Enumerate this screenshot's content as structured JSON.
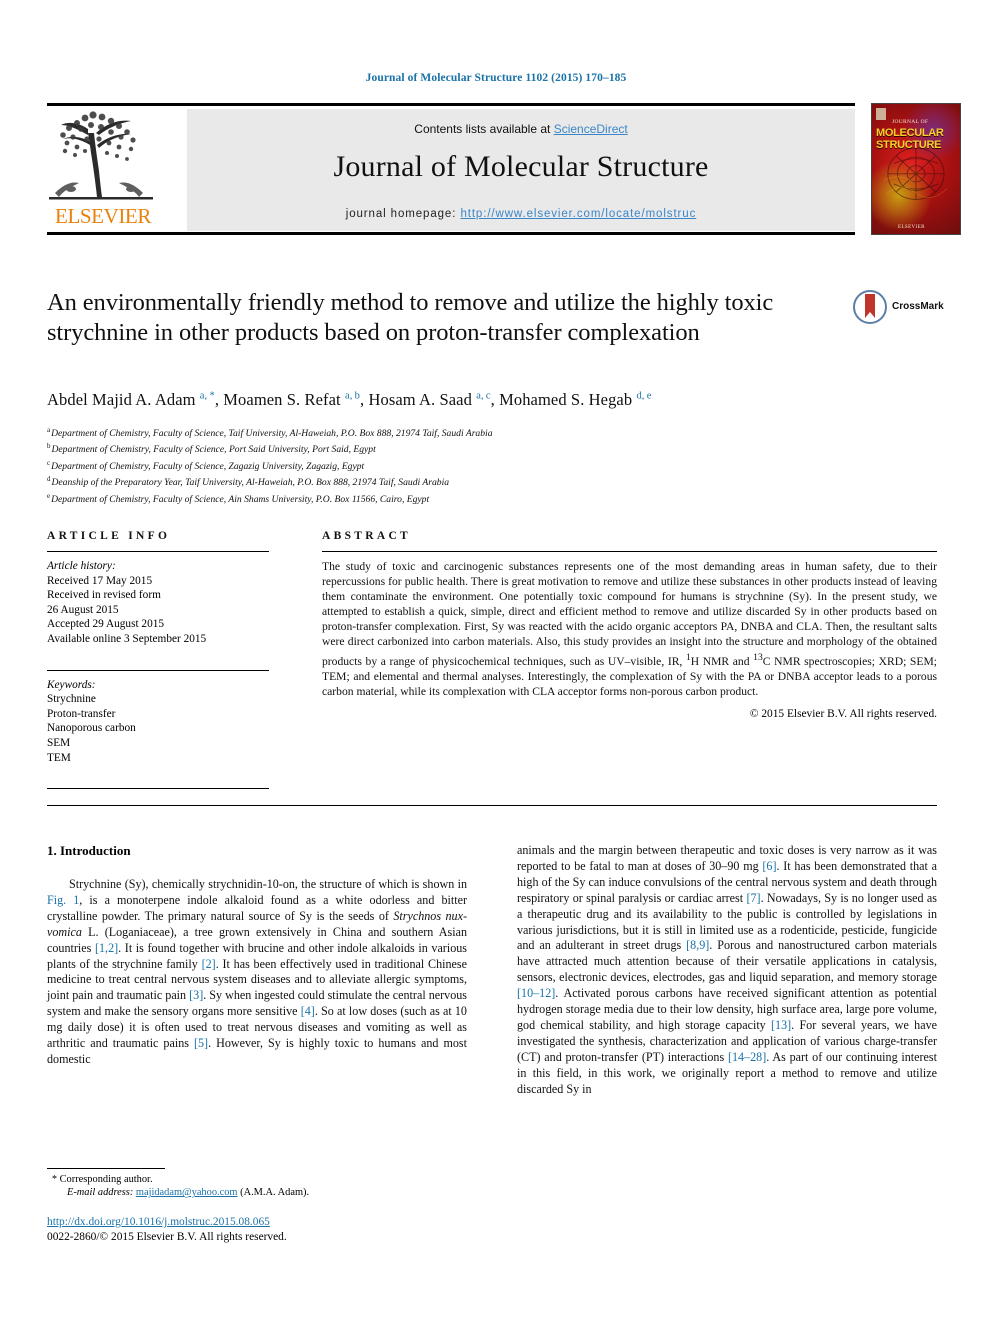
{
  "running_head": "Journal of Molecular Structure 1102 (2015) 170–185",
  "masthead": {
    "contents_prefix": "Contents lists available at ",
    "sciencedirect": "ScienceDirect",
    "journal_name": "Journal of Molecular Structure",
    "homepage_prefix": "journal homepage: ",
    "homepage_url": "http://www.elsevier.com/locate/molstruc",
    "publisher_logo_text": "ELSEVIER",
    "cover": {
      "sub": "JOURNAL OF",
      "title": "MOLECULAR STRUCTURE",
      "publisher": "ELSEVIER"
    }
  },
  "article": {
    "title": "An environmentally friendly method to remove and utilize the highly toxic strychnine in other products based on proton-transfer complexation",
    "crossmark_label": "CrossMark",
    "authors_html": "Abdel Majid A. Adam <sup class=\"sup-aff\">a, *</sup>, Moamen S. Refat <sup class=\"sup-aff\">a, b</sup>, Hosam A. Saad <sup class=\"sup-aff\">a, c</sup>, Mohamed S. Hegab <sup class=\"sup-aff\">d, e</sup>",
    "affiliations": [
      {
        "mark": "a",
        "text": "Department of Chemistry, Faculty of Science, Taif University, Al-Haweiah, P.O. Box 888, 21974 Taif, Saudi Arabia"
      },
      {
        "mark": "b",
        "text": "Department of Chemistry, Faculty of Science, Port Said University, Port Said, Egypt"
      },
      {
        "mark": "c",
        "text": "Department of Chemistry, Faculty of Science, Zagazig University, Zagazig, Egypt"
      },
      {
        "mark": "d",
        "text": "Deanship of the Preparatory Year, Taif University, Al-Haweiah, P.O. Box 888, 21974 Taif, Saudi Arabia"
      },
      {
        "mark": "e",
        "text": "Department of Chemistry, Faculty of Science, Ain Shams University, P.O. Box 11566, Cairo, Egypt"
      }
    ]
  },
  "article_info": {
    "heading": "ARTICLE INFO",
    "history_label": "Article history:",
    "history": [
      "Received 17 May 2015",
      "Received in revised form",
      "26 August 2015",
      "Accepted 29 August 2015",
      "Available online 3 September 2015"
    ],
    "keywords_label": "Keywords:",
    "keywords": [
      "Strychnine",
      "Proton-transfer",
      "Nanoporous carbon",
      "SEM",
      "TEM"
    ]
  },
  "abstract": {
    "heading": "ABSTRACT",
    "text": "The study of toxic and carcinogenic substances represents one of the most demanding areas in human safety, due to their repercussions for public health. There is great motivation to remove and utilize these substances in other products instead of leaving them contaminate the environment. One potentially toxic compound for humans is strychnine (Sy). In the present study, we attempted to establish a quick, simple, direct and efficient method to remove and utilize discarded Sy in other products based on proton-transfer complexation. First, Sy was reacted with the acido organic acceptors PA, DNBA and CLA. Then, the resultant salts were direct carbonized into carbon materials. Also, this study provides an insight into the structure and morphology of the obtained products by a range of physicochemical techniques, such as UV–visible, IR, <sup>1</sup>H NMR and <sup>13</sup>C NMR spectroscopies; XRD; SEM; TEM; and elemental and thermal analyses. Interestingly, the complexation of Sy with the PA or DNBA acceptor leads to a porous carbon material, while its complexation with CLA acceptor forms non-porous carbon product.",
    "copyright": "© 2015 Elsevier B.V. All rights reserved."
  },
  "body": {
    "section_title": "1. Introduction",
    "left_paragraph_html": "Strychnine (Sy), chemically strychnidin-10-on, the structure of which is shown in <span class=\"ref\">Fig. 1</span>, is a monoterpene indole alkaloid found as a white odorless and bitter crystalline powder. The primary natural source of Sy is the seeds of <i>Strychnos nux-vomica</i> L. (Loganiaceae), a tree grown extensively in China and southern Asian countries <span class=\"ref\">[1,2]</span>. It is found together with brucine and other indole alkaloids in various plants of the strychnine family <span class=\"ref\">[2]</span>. It has been effectively used in traditional Chinese medicine to treat central nervous system diseases and to alleviate allergic symptoms, joint pain and traumatic pain <span class=\"ref\">[3]</span>. Sy when ingested could stimulate the central nervous system and make the sensory organs more sensitive <span class=\"ref\">[4]</span>. So at low doses (such as at 10 mg daily dose) it is often used to treat nervous diseases and vomiting as well as arthritic and traumatic pains <span class=\"ref\">[5]</span>. However, Sy is highly toxic to humans and most domestic",
    "right_paragraph_html": "animals and the margin between therapeutic and toxic doses is very narrow as it was reported to be fatal to man at doses of 30–90 mg <span class=\"ref\">[6]</span>. It has been demonstrated that a high of the Sy can induce convulsions of the central nervous system and death through respiratory or spinal paralysis or cardiac arrest <span class=\"ref\">[7]</span>. Nowadays, Sy is no longer used as a therapeutic drug and its availability to the public is controlled by legislations in various jurisdictions, but it is still in limited use as a rodenticide, pesticide, fungicide and an adulterant in street drugs <span class=\"ref\">[8,9]</span>. Porous and nanostructured carbon materials have attracted much attention because of their versatile applications in catalysis, sensors, electronic devices, electrodes, gas and liquid separation, and memory storage <span class=\"ref\">[10–12]</span>. Activated porous carbons have received significant attention as potential hydrogen storage media due to their low density, high surface area, large pore volume, god chemical stability, and high storage capacity <span class=\"ref\">[13]</span>. For several years, we have investigated the synthesis, characterization and application of various charge-transfer (CT) and proton-transfer (PT) interactions <span class=\"ref\">[14–28]</span>. As part of our continuing interest in this field, in this work, we originally report a method to remove and utilize discarded Sy in"
  },
  "footer": {
    "corresponding_star": "*",
    "corresponding_label": "Corresponding author.",
    "email_label": "E-mail address:",
    "email": "majidadam@yahoo.com",
    "email_owner": "(A.M.A. Adam).",
    "doi": "http://dx.doi.org/10.1016/j.molstruc.2015.08.065",
    "issn_line": "0022-2860/© 2015 Elsevier B.V. All rights reserved."
  },
  "colors": {
    "link_blue": "#1a72a8",
    "sciencedirect_blue": "#3a86c8",
    "elsevier_orange": "#E8820C",
    "panel_gray": "#e9e9e9"
  }
}
